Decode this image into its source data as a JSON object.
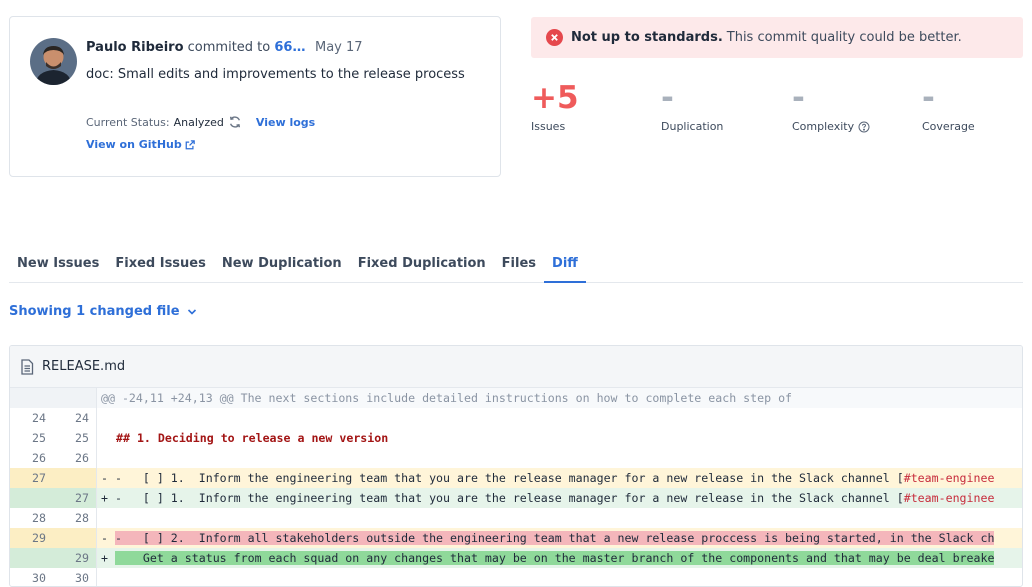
{
  "commit": {
    "author": "Paulo Ribeiro",
    "committed_to": "commited to",
    "sha": "66…",
    "date": "May 17",
    "message": "doc: Small edits and improvements to the release process",
    "status_label": "Current Status:",
    "status_value": "Analyzed",
    "view_logs": "View logs",
    "github_link": "View on GitHub"
  },
  "alert": {
    "strong": "Not up to standards.",
    "text": "This commit quality could be better.",
    "color": "#e5484d"
  },
  "metrics": [
    {
      "value": "+5",
      "label": "Issues"
    },
    {
      "value": "-",
      "label": "Duplication"
    },
    {
      "value": "-",
      "label": "Complexity"
    },
    {
      "value": "-",
      "label": "Coverage"
    }
  ],
  "tabs": [
    "New Issues",
    "Fixed Issues",
    "New Duplication",
    "Fixed Duplication",
    "Files",
    "Diff"
  ],
  "active_tab": "Diff",
  "changed_files": "Showing 1 changed file",
  "diff": {
    "file_name": "RELEASE.md",
    "hunk": "@@ -24,11 +24,13 @@ The next sections include detailed instructions on how to complete each step of",
    "lines": [
      {
        "type": "context",
        "old": "24",
        "new": "24",
        "text": ""
      },
      {
        "type": "context",
        "old": "25",
        "new": "25",
        "text": "## 1. Deciding to release a new version"
      },
      {
        "type": "context",
        "old": "26",
        "new": "26",
        "text": ""
      },
      {
        "type": "del",
        "old": "27",
        "new": "",
        "marker": "-",
        "text": "-   [ ] 1.  Inform the engineering team that you are the release manager for a new release in the Slack channel [",
        "tag": "#team-enginee"
      },
      {
        "type": "add",
        "old": "",
        "new": "27",
        "marker": "+",
        "text": "-   [ ] 1.  Inform the engineering team that you are the release manager for a new release in the Slack channel [",
        "tag": "#team-enginee"
      },
      {
        "type": "context",
        "old": "28",
        "new": "28",
        "text": ""
      },
      {
        "type": "del",
        "old": "29",
        "new": "",
        "marker": "-",
        "text": "-   [ ] 2.  Inform all stakeholders outside the engineering team that a new release proccess is being started, in the Slack ch"
      },
      {
        "type": "add",
        "old": "",
        "new": "29",
        "marker": "+",
        "text": "    Get a status from each squad on any changes that may be on the master branch of the components and that may be deal breake"
      },
      {
        "type": "context",
        "old": "30",
        "new": "30",
        "text": ""
      }
    ]
  }
}
